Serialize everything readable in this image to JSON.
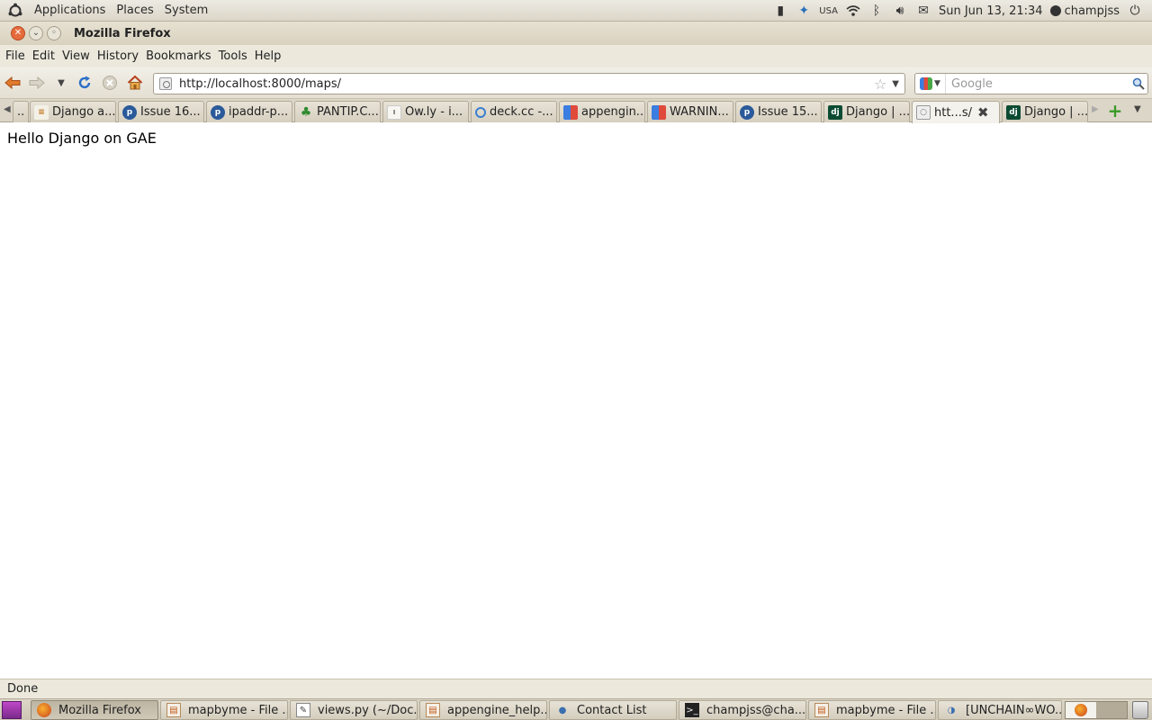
{
  "top_panel": {
    "menus": [
      "Applications",
      "Places",
      "System"
    ],
    "keyboard_layout": "USA",
    "clock": "Sun Jun 13, 21:34",
    "user": "champjss"
  },
  "window": {
    "title": "Mozilla Firefox"
  },
  "menubar": {
    "items": [
      "File",
      "Edit",
      "View",
      "History",
      "Bookmarks",
      "Tools",
      "Help"
    ]
  },
  "navbar": {
    "url": "http://localhost:8000/maps/",
    "search_placeholder": "Google"
  },
  "tabs": [
    {
      "label": "..",
      "favicon": "ellipsis"
    },
    {
      "label": "Django a...",
      "favicon": "stackoverflow-icon"
    },
    {
      "label": "Issue 16...",
      "favicon": "project-icon"
    },
    {
      "label": "ipaddr-p...",
      "favicon": "project-icon"
    },
    {
      "label": "PANTIP.C...",
      "favicon": "cactus-icon"
    },
    {
      "label": "Ow.ly - i...",
      "favicon": "owly-icon"
    },
    {
      "label": "deck.cc -...",
      "favicon": "deck-icon"
    },
    {
      "label": "appengin...",
      "favicon": "google-icon"
    },
    {
      "label": "WARNIN...",
      "favicon": "google-icon"
    },
    {
      "label": "Issue 15...",
      "favicon": "project-icon"
    },
    {
      "label": "Django | ...",
      "favicon": "django-icon"
    },
    {
      "label": "htt...s/",
      "favicon": "page-icon",
      "active": true
    },
    {
      "label": "Django | ...",
      "favicon": "django-icon"
    }
  ],
  "content": {
    "body_text": "Hello Django on GAE"
  },
  "statusbar": {
    "text": "Done"
  },
  "taskbar": {
    "items": [
      {
        "label": "Mozilla Firefox",
        "icon": "firefox-icon",
        "active": true
      },
      {
        "label": "mapbyme - File ...",
        "icon": "file-browser-icon"
      },
      {
        "label": "views.py (~/Doc...",
        "icon": "text-editor-icon"
      },
      {
        "label": "appengine_help...",
        "icon": "file-browser-icon"
      },
      {
        "label": "Contact List",
        "icon": "contact-icon"
      },
      {
        "label": "champjss@cha...",
        "icon": "terminal-icon"
      },
      {
        "label": "mapbyme - File ...",
        "icon": "file-browser-icon"
      },
      {
        "label": "[UNCHAIN∞WO...",
        "icon": "messenger-icon"
      }
    ]
  },
  "colors": {
    "panel_bg": "#dcd6c8",
    "close_button": "#e66b3c",
    "content_bg": "#ffffff"
  }
}
